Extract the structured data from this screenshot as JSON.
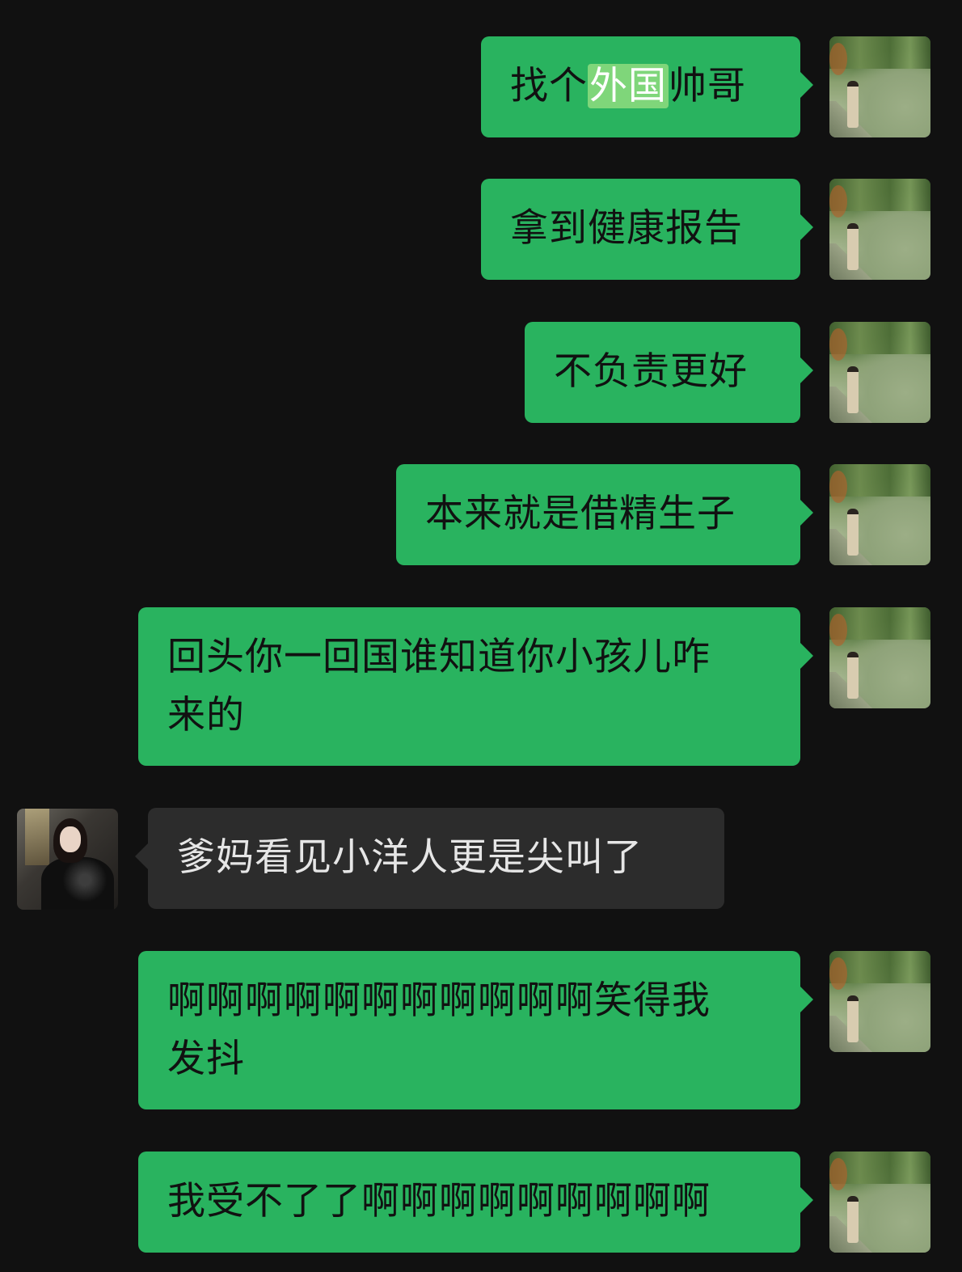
{
  "messages": [
    {
      "sender": "me",
      "pre": "找个",
      "highlight": "外国",
      "post": "帅哥"
    },
    {
      "sender": "me",
      "text": "拿到健康报告"
    },
    {
      "sender": "me",
      "text": "不负责更好"
    },
    {
      "sender": "me",
      "text": "本来就是借精生子"
    },
    {
      "sender": "me",
      "line1": "回头你一回国谁知道你小孩儿咋",
      "line2": "来的"
    },
    {
      "sender": "other",
      "text": "爹妈看见小洋人更是尖叫了"
    },
    {
      "sender": "me",
      "line1": "啊啊啊啊啊啊啊啊啊啊啊笑得我",
      "line2": "发抖"
    },
    {
      "sender": "me",
      "text": "我受不了了啊啊啊啊啊啊啊啊啊"
    }
  ],
  "colors": {
    "background": "#111111",
    "my_bubble": "#29b35f",
    "other_bubble": "#2c2c2c",
    "highlight": "#7fd67a"
  },
  "avatars": {
    "me": "lake-portrait-avatar",
    "other": "woman-black-coat-avatar"
  }
}
